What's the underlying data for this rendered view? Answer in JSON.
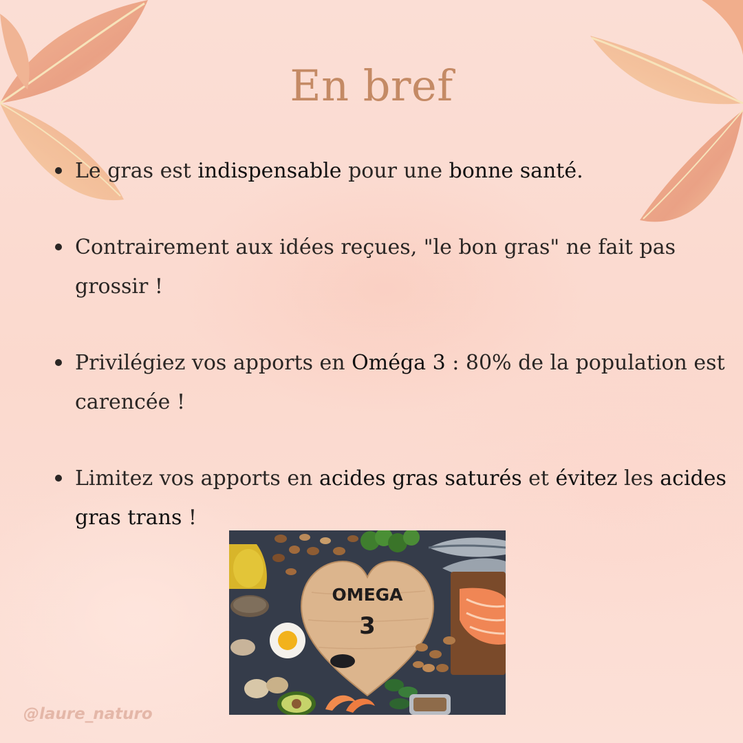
{
  "page": {
    "title": "En bref",
    "handle": "@laure_naturo",
    "colors": {
      "title": "#c48a65",
      "background": "#fbdcd2",
      "text": "#2a2624",
      "handle": "#e4b7a8"
    }
  },
  "bullets": [
    {
      "parts": [
        "Le gras est ",
        "indispensable",
        " pour une ",
        "bonne santé."
      ]
    },
    {
      "parts": [
        "Contrairement aux idées reçues, \"le bon gras\" ne fait pas grossir !"
      ]
    },
    {
      "parts": [
        "Privilégiez vos apports en ",
        "Oméga 3",
        " : 80% de la population est carencée !"
      ]
    },
    {
      "parts": [
        "Limitez vos apports en ",
        "acides gras saturés",
        " et ",
        "évitez",
        " les ",
        "acides gras trans",
        " !"
      ]
    }
  ],
  "photo": {
    "heart_text_line1": "OMEGA",
    "heart_text_line2": "3"
  }
}
